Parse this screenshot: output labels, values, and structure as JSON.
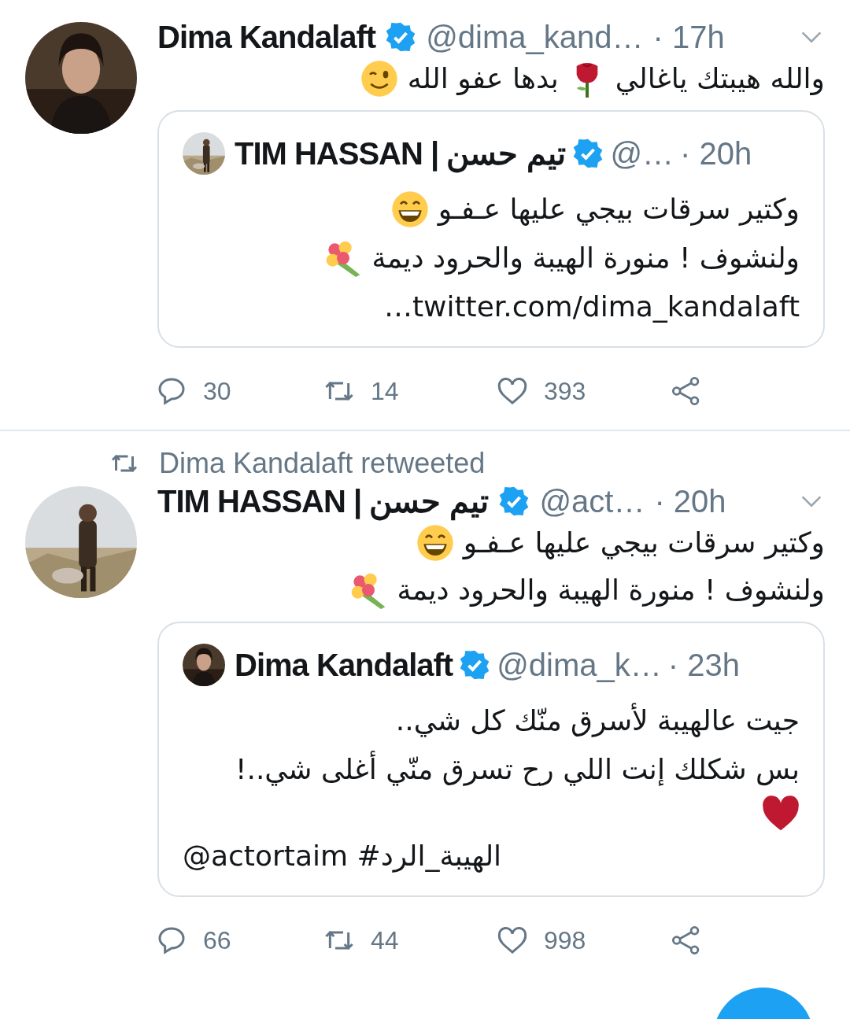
{
  "tweets": [
    {
      "author": "Dima Kandalaft",
      "verified": true,
      "handle": "@dima_kand…",
      "time": "· 17h",
      "lines": [
        [
          {
            "kind": "text",
            "text": "والله هيبتك ياغالي"
          },
          {
            "kind": "rose"
          },
          {
            "kind": "text",
            "text": "بدها عفو الله"
          },
          {
            "kind": "wink"
          }
        ]
      ],
      "quote": {
        "author": "TIM HASSAN | تيم حسن",
        "verified": true,
        "handle": "@…",
        "time": "· 20h",
        "lines": [
          [
            {
              "kind": "text",
              "text": "وكتير سرقات بيجي عليها عـفـو"
            },
            {
              "kind": "grin"
            }
          ],
          [
            {
              "kind": "text",
              "text": "ولنشوف ! منورة الهيبة والحرود ديمة"
            },
            {
              "kind": "bouquet"
            }
          ],
          [
            {
              "kind": "text",
              "text": "twitter.com/dima_kandalaft…"
            }
          ]
        ]
      },
      "actions": {
        "replies": "30",
        "retweets": "14",
        "likes": "393"
      }
    },
    {
      "retweeted_by": "Dima Kandalaft retweeted",
      "author": "TIM HASSAN | تيم حسن",
      "verified": true,
      "handle": "@act…",
      "time": "· 20h",
      "lines": [
        [
          {
            "kind": "text",
            "text": "وكتير سرقات بيجي عليها عـفـو"
          },
          {
            "kind": "grin"
          }
        ],
        [
          {
            "kind": "text",
            "text": "ولنشوف ! منورة الهيبة والحرود ديمة"
          },
          {
            "kind": "bouquet"
          }
        ]
      ],
      "quote": {
        "author": "Dima Kandalaft",
        "verified": true,
        "handle": "@dima_k…",
        "time": "· 23h",
        "lines": [
          [
            {
              "kind": "text",
              "text": "جيت عالهيبة لأسرق منّك كل شي.."
            }
          ],
          [
            {
              "kind": "text",
              "text": "بس شكلك إنت اللي رح تسرق منّي أغلى شي..!"
            }
          ],
          [
            {
              "kind": "heart"
            }
          ]
        ],
        "tags": "@actortaim #الهيبة_الرد"
      },
      "actions": {
        "replies": "66",
        "retweets": "44",
        "likes": "998"
      }
    }
  ]
}
